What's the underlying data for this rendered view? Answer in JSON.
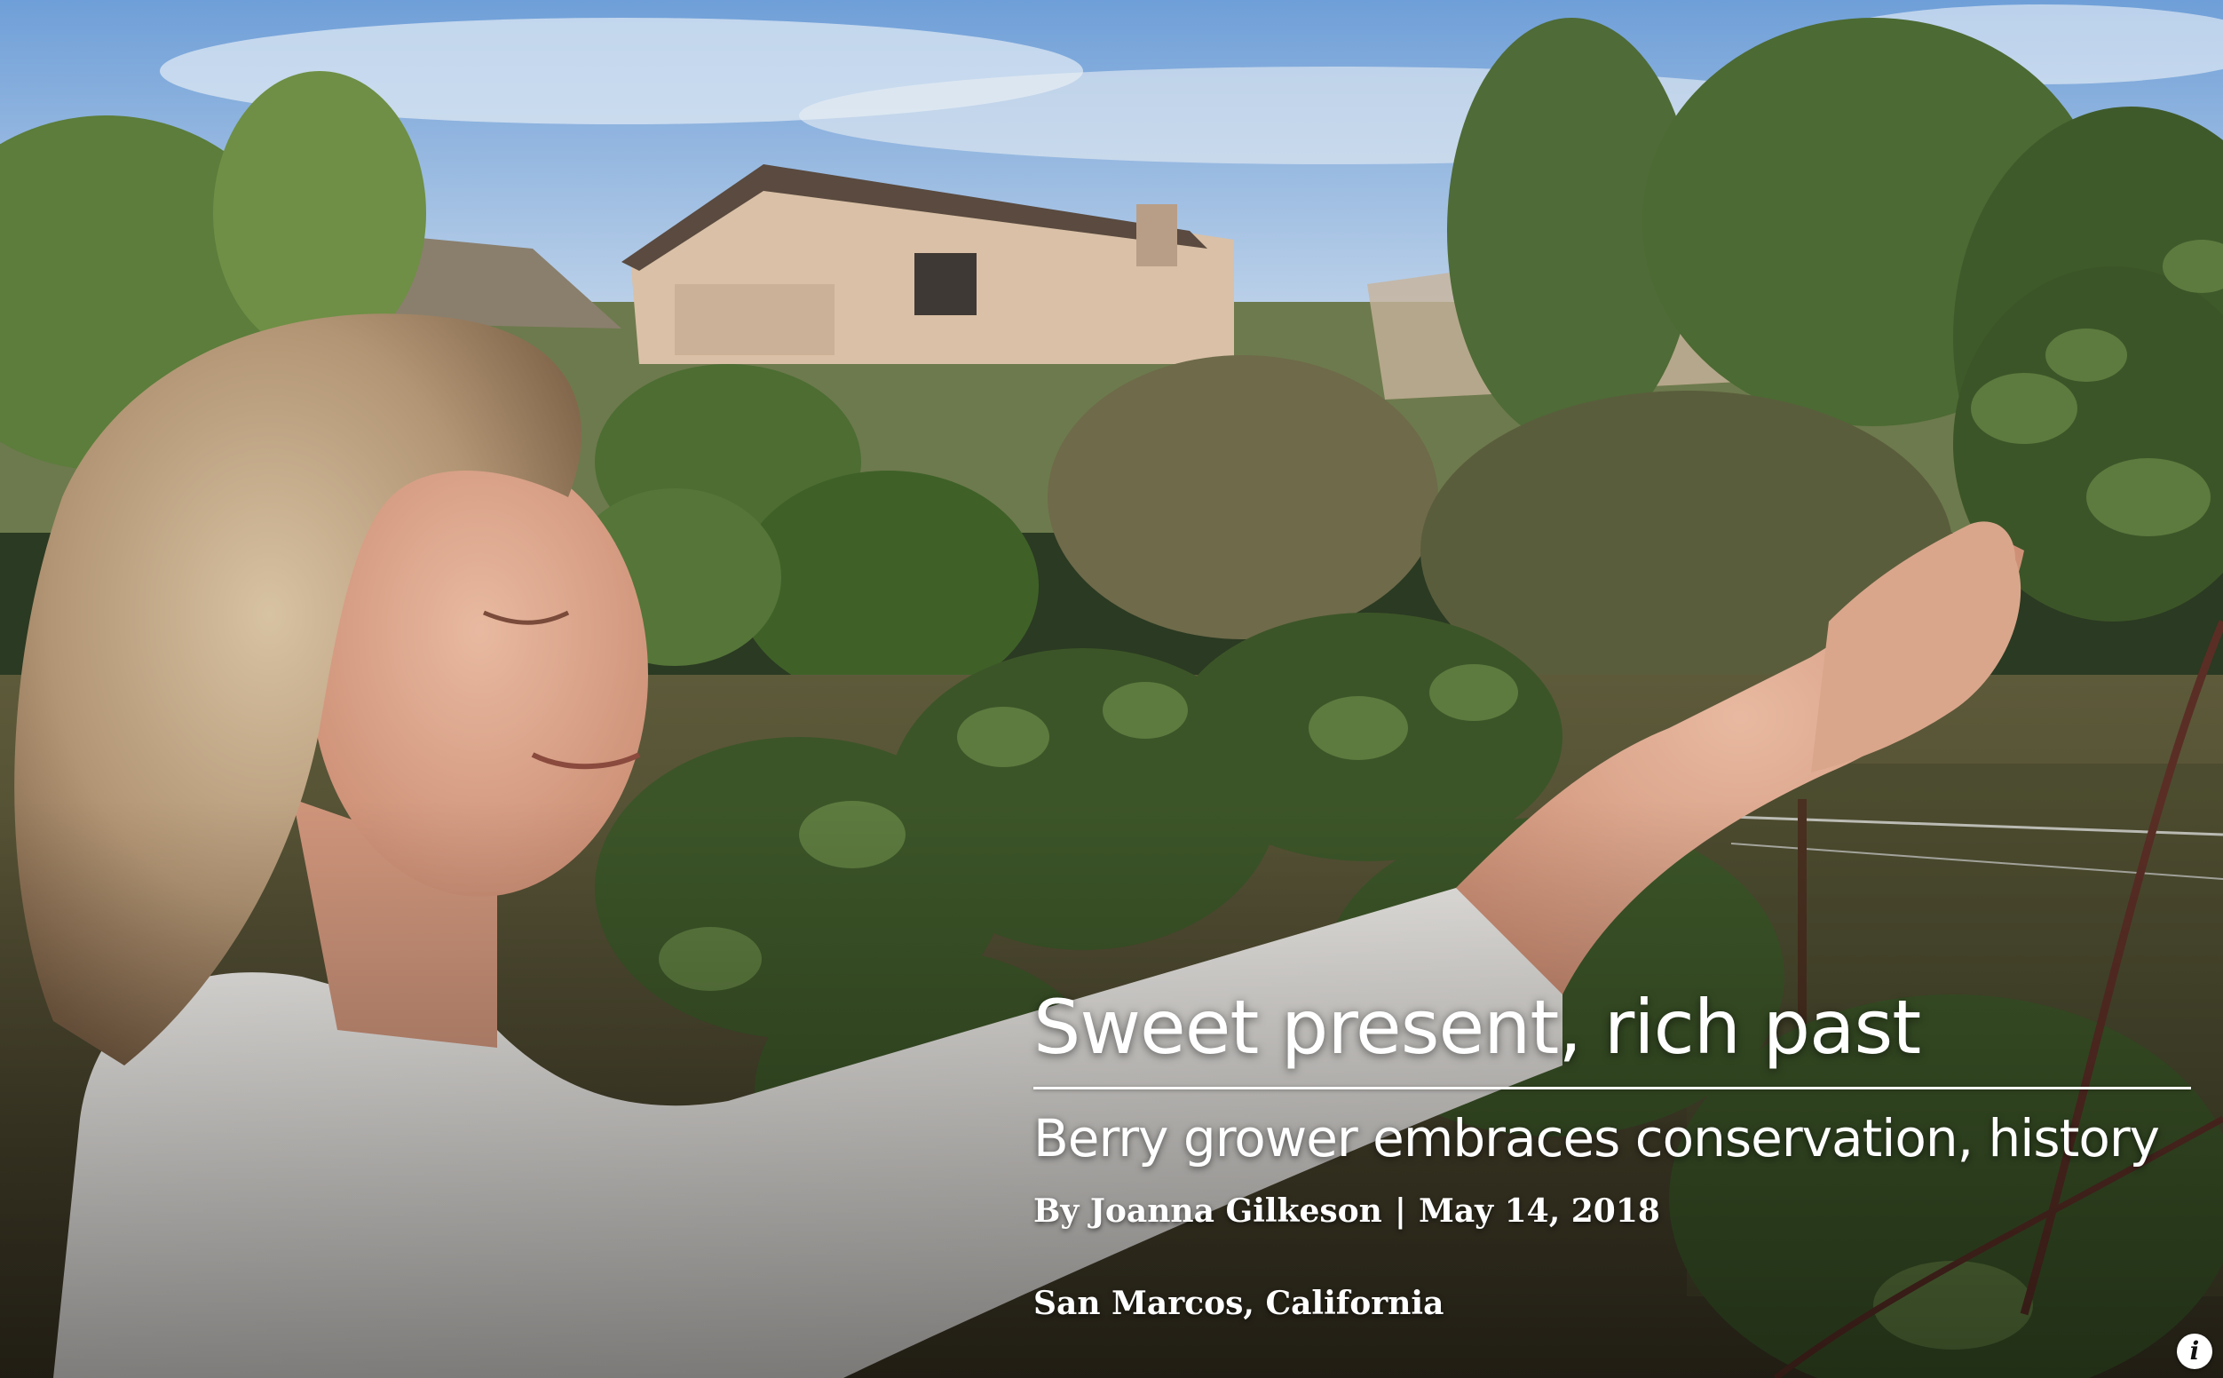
{
  "story": {
    "title": "Sweet present, rich past",
    "subtitle": "Berry grower embraces conservation, history",
    "byline": {
      "author": "By Joanna Gilkeson",
      "separator": "|",
      "date": "May 14, 2018"
    },
    "location": "San Marcos, California"
  },
  "controls": {
    "info_icon": "i"
  },
  "colors": {
    "title_text": "#ffffff",
    "sky": "#a9c4e6",
    "foliage": "#3f5a2a"
  }
}
